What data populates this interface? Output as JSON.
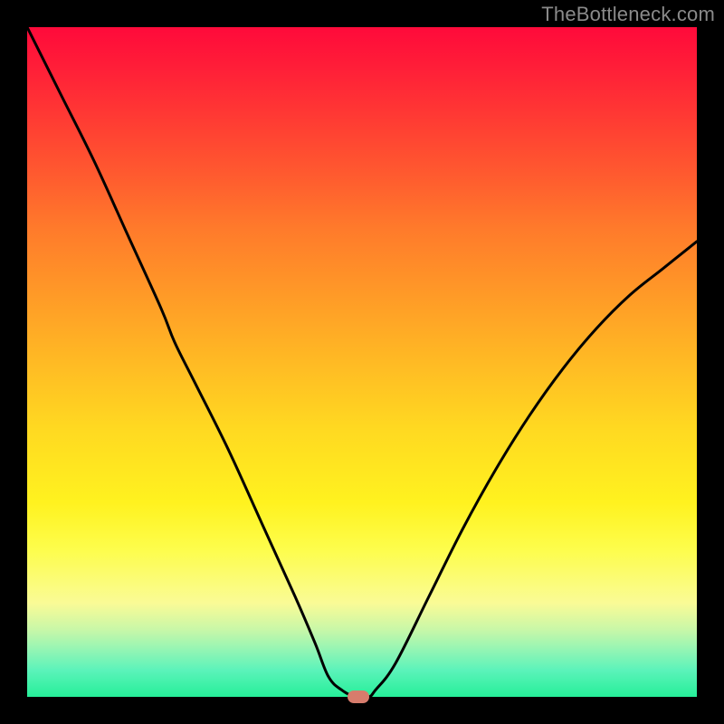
{
  "watermark": "TheBottleneck.com",
  "chart_data": {
    "type": "line",
    "title": "",
    "xlabel": "",
    "ylabel": "",
    "xlim": [
      0,
      100
    ],
    "ylim": [
      0,
      100
    ],
    "series": [
      {
        "name": "bottleneck-curve",
        "x": [
          0,
          5,
          10,
          15,
          20,
          22,
          25,
          30,
          35,
          40,
          43,
          45,
          47,
          49,
          51,
          52,
          55,
          60,
          65,
          70,
          75,
          80,
          85,
          90,
          95,
          100
        ],
        "values": [
          100,
          90,
          80,
          69,
          58,
          53,
          47,
          37,
          26,
          15,
          8,
          3,
          1,
          0,
          0,
          1,
          5,
          15,
          25,
          34,
          42,
          49,
          55,
          60,
          64,
          68
        ]
      }
    ],
    "marker": {
      "x": 49.5,
      "y": 0,
      "color": "#d77c6c"
    },
    "background_gradient": {
      "top": "#ff0a3a",
      "bottom": "#26ef99"
    }
  }
}
